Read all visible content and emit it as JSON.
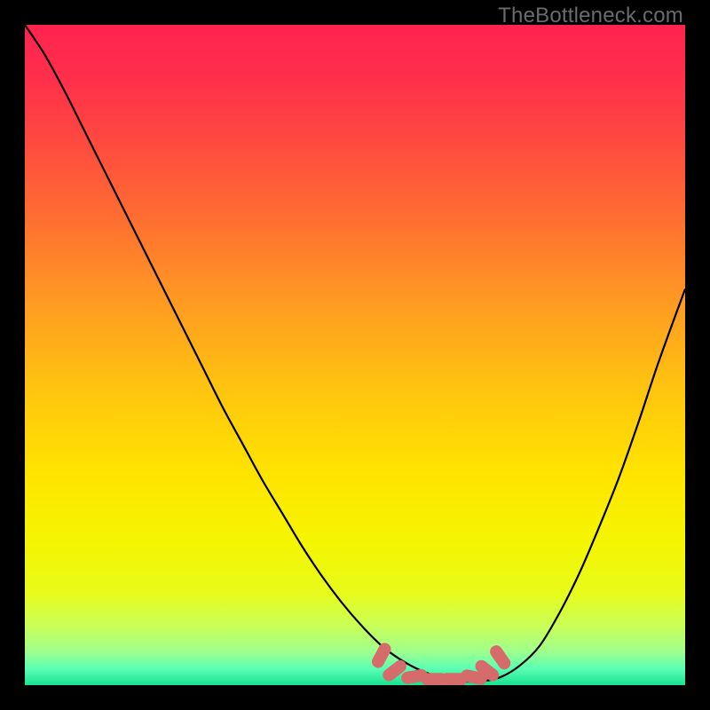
{
  "watermark": "TheBottleneck.com",
  "gradient": {
    "stops": [
      {
        "offset": 0.0,
        "color": "#ff2350"
      },
      {
        "offset": 0.08,
        "color": "#ff2f4b"
      },
      {
        "offset": 0.18,
        "color": "#ff4a3f"
      },
      {
        "offset": 0.3,
        "color": "#ff7030"
      },
      {
        "offset": 0.42,
        "color": "#ff9a22"
      },
      {
        "offset": 0.55,
        "color": "#ffc40f"
      },
      {
        "offset": 0.68,
        "color": "#ffe400"
      },
      {
        "offset": 0.78,
        "color": "#f5f500"
      },
      {
        "offset": 0.86,
        "color": "#e8fb1a"
      },
      {
        "offset": 0.91,
        "color": "#c9ff57"
      },
      {
        "offset": 0.95,
        "color": "#9dff8e"
      },
      {
        "offset": 0.975,
        "color": "#5bffb4"
      },
      {
        "offset": 1.0,
        "color": "#17e38f"
      }
    ]
  },
  "chart_data": {
    "type": "line",
    "title": "",
    "xlabel": "",
    "ylabel": "",
    "xlim": [
      0,
      100
    ],
    "ylim": [
      0,
      100
    ],
    "grid": false,
    "x": [
      0,
      3,
      6,
      9,
      12,
      15,
      18,
      21,
      24,
      27,
      30,
      33,
      36,
      39,
      42,
      45,
      48,
      51,
      54,
      57,
      60,
      63,
      66,
      69,
      72,
      75,
      78,
      81,
      84,
      87,
      90,
      93,
      96,
      100
    ],
    "series": [
      {
        "name": "curve",
        "color": "#000000",
        "values": [
          100,
          95.5,
          90,
          84,
          78,
          72,
          66,
          60,
          54,
          48,
          42,
          36.5,
          31,
          26,
          21,
          16.5,
          12.5,
          9,
          6,
          3.8,
          2.2,
          1.2,
          0.6,
          0.6,
          1.2,
          3,
          6,
          11,
          17,
          24,
          31.5,
          40,
          49,
          60
        ]
      }
    ],
    "markers": {
      "name": "observed-points",
      "color": "#d66b6b",
      "shape": "capsule",
      "x": [
        54,
        56,
        59,
        62,
        65,
        68,
        70,
        72
      ],
      "values": [
        4.5,
        2.2,
        1.3,
        0.9,
        0.9,
        1.2,
        2.2,
        4.2
      ],
      "angles": [
        -62,
        -38,
        -10,
        0,
        0,
        12,
        38,
        55
      ]
    }
  }
}
